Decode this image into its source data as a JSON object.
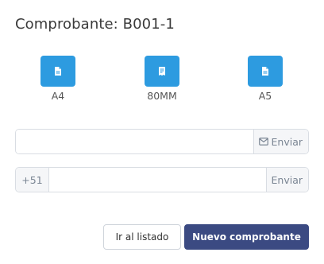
{
  "title": "Comprobante: B001-1",
  "formats": [
    {
      "label": "A4",
      "icon": "file-text-icon"
    },
    {
      "label": "80MM",
      "icon": "receipt-icon"
    },
    {
      "label": "A5",
      "icon": "file-text-icon"
    }
  ],
  "email": {
    "value": "",
    "placeholder": "",
    "send_label": "Enviar",
    "icon": "mail-icon"
  },
  "whatsapp": {
    "prefix": "+51",
    "value": "",
    "placeholder": "",
    "send_label": "Enviar"
  },
  "actions": {
    "back_label": "Ir al listado",
    "new_label": "Nuevo comprobante"
  },
  "colors": {
    "format_tile": "#2d9be0",
    "primary_button": "#3b4a82"
  }
}
